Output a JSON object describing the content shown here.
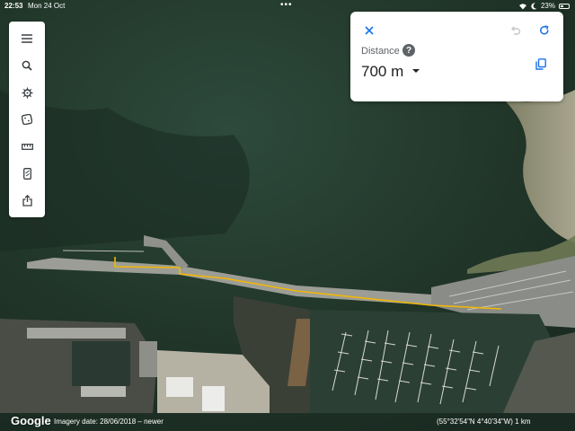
{
  "status_bar": {
    "time": "22:53",
    "date": "Mon 24 Oct",
    "battery": "23%"
  },
  "toolbar": {
    "icons": [
      "menu-icon",
      "search-icon",
      "voyager-icon",
      "dice-icon",
      "ruler-icon",
      "phone-icon",
      "share-icon"
    ]
  },
  "measure_panel": {
    "label": "Distance",
    "help": "?",
    "value": "700 m"
  },
  "footer": {
    "logo": "Google",
    "imagery": "Imagery date: 28/06/2018 – newer",
    "coordinates": "(55°32'54\"N 4°40'34\"W) 1 km"
  },
  "colors": {
    "measure_line": "#f2b705",
    "accent": "#1a73e8"
  }
}
